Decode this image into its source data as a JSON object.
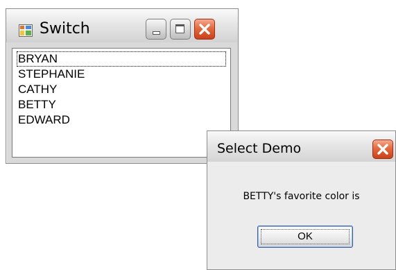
{
  "switch_window": {
    "title": "Switch",
    "icon": "app-window-icon",
    "buttons": [
      "minimize-icon",
      "maximize-icon",
      "close-icon"
    ],
    "list_items": [
      {
        "label": "BRYAN",
        "focused": true
      },
      {
        "label": "STEPHANIE",
        "focused": false
      },
      {
        "label": "CATHY",
        "focused": false
      },
      {
        "label": "BETTY",
        "focused": false
      },
      {
        "label": "EDWARD",
        "focused": false
      }
    ]
  },
  "dialog": {
    "title": "Select Demo",
    "message": "BETTY's favorite color is",
    "ok_label": "OK",
    "close_icon": "close-icon"
  },
  "colors": {
    "close_button": "#d64a22",
    "titlebar": "#e6e6e6",
    "window_face": "#d9d9d9",
    "dialog_face": "#ececec"
  }
}
